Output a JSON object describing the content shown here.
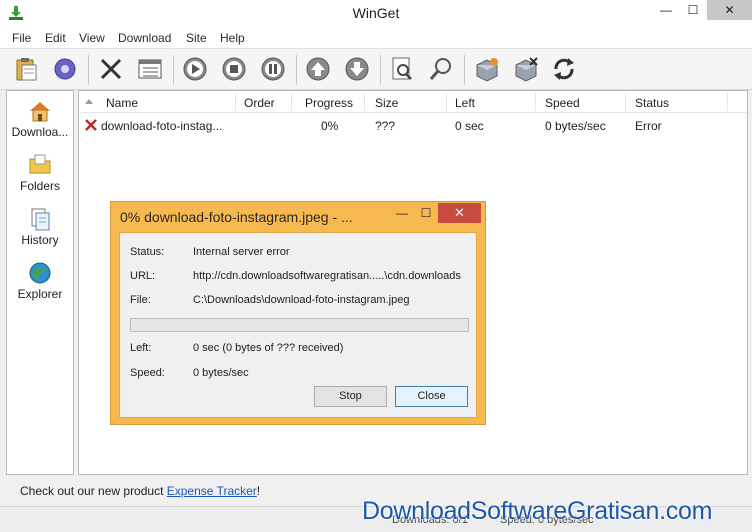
{
  "window": {
    "title": "WinGet",
    "min_glyph": "—",
    "max_glyph": "☐",
    "close_glyph": "✕"
  },
  "menu": [
    "File",
    "Edit",
    "View",
    "Download",
    "Site",
    "Help"
  ],
  "toolbar": {
    "buttons": [
      "paste-icon",
      "settings-icon",
      "delete-icon",
      "list-icon",
      "start-icon",
      "stop-icon",
      "pause-icon",
      "move-up-icon",
      "move-down-icon",
      "preview-icon",
      "search-icon",
      "add-site-icon",
      "remove-site-icon",
      "refresh-icon"
    ]
  },
  "nav": [
    {
      "label": "Downloa...",
      "icon": "home-icon"
    },
    {
      "label": "Folders",
      "icon": "folders-icon"
    },
    {
      "label": "History",
      "icon": "history-icon"
    },
    {
      "label": "Explorer",
      "icon": "explorer-icon"
    }
  ],
  "list": {
    "columns": [
      "Name",
      "Order",
      "Progress",
      "Size",
      "Left",
      "Speed",
      "Status"
    ],
    "rows": [
      {
        "name": "download-foto-instag...",
        "order": "",
        "progress": "0%",
        "size": "???",
        "left": "0 sec",
        "speed": "0 bytes/sec",
        "status": "Error"
      }
    ]
  },
  "dialog": {
    "title": "0% download-foto-instagram.jpeg - ...",
    "min_glyph": "—",
    "max_glyph": "☐",
    "close_glyph": "✕",
    "status_label": "Status:",
    "status_value": "Internal server error",
    "url_label": "URL:",
    "url_value": "http://cdn.downloadsoftwaregratisan.....\\cdn.downloads",
    "file_label": "File:",
    "file_value": "C:\\Downloads\\download-foto-instagram.jpeg",
    "progress": 0,
    "left_label": "Left:",
    "left_value": "0 sec (0 bytes of ??? received)",
    "speed_label": "Speed:",
    "speed_value": "0 bytes/sec",
    "stop_label": "Stop",
    "close_label": "Close"
  },
  "promo": {
    "prefix": "Check out our new product ",
    "link": "Expense Tracker",
    "suffix": "!"
  },
  "statusbar": {
    "downloads": "Downloads: 0/1",
    "speed": "Speed: 0 bytes/sec"
  },
  "watermark": "DownloadSoftwareGratisan.com",
  "colors": {
    "accent": "#f6b94f",
    "close_red": "#c74b3e",
    "link": "#1a56c7",
    "error": "#c0282a"
  }
}
